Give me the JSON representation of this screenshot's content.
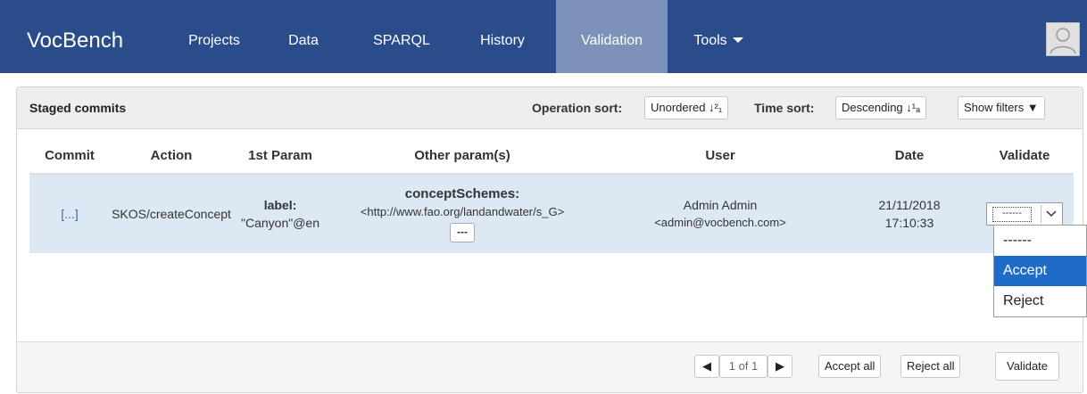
{
  "nav": {
    "brand": "VocBench",
    "items": [
      "Projects",
      "Data",
      "SPARQL",
      "History",
      "Validation",
      "Tools"
    ]
  },
  "panel": {
    "title": "Staged commits",
    "operation_sort_label": "Operation sort:",
    "operation_sort_value": "Unordered ↓²₁",
    "time_sort_label": "Time sort:",
    "time_sort_value": "Descending ↓¹ₐ",
    "show_filters": "Show filters ▼"
  },
  "table": {
    "headers": [
      "Commit",
      "Action",
      "1st Param",
      "Other param(s)",
      "User",
      "Date",
      "Validate"
    ],
    "row": {
      "commit": "[...]",
      "action": "SKOS/createConcept",
      "param1_name": "label:",
      "param1_value": "\"Canyon\"@en",
      "other_name": "conceptSchemes:",
      "other_value": "<http://www.fao.org/landandwater/s_G>",
      "other_more": "---",
      "user_name": "Admin Admin",
      "user_email": "<admin@vocbench.com>",
      "date": "21/11/2018",
      "time": "17:10:33",
      "validate_value": "------"
    }
  },
  "dropdown": {
    "options": [
      "------",
      "Accept",
      "Reject"
    ],
    "highlighted": "Accept"
  },
  "footer": {
    "prev": "◀",
    "page": "1 of 1",
    "next": "▶",
    "accept_all": "Accept all",
    "reject_all": "Reject all",
    "validate": "Validate"
  },
  "colors": {
    "navbar": "#2b4c8a",
    "nav_active": "#7d92b9",
    "row_highlight": "#dde8f5",
    "dropdown_highlight": "#1e6cc8"
  }
}
